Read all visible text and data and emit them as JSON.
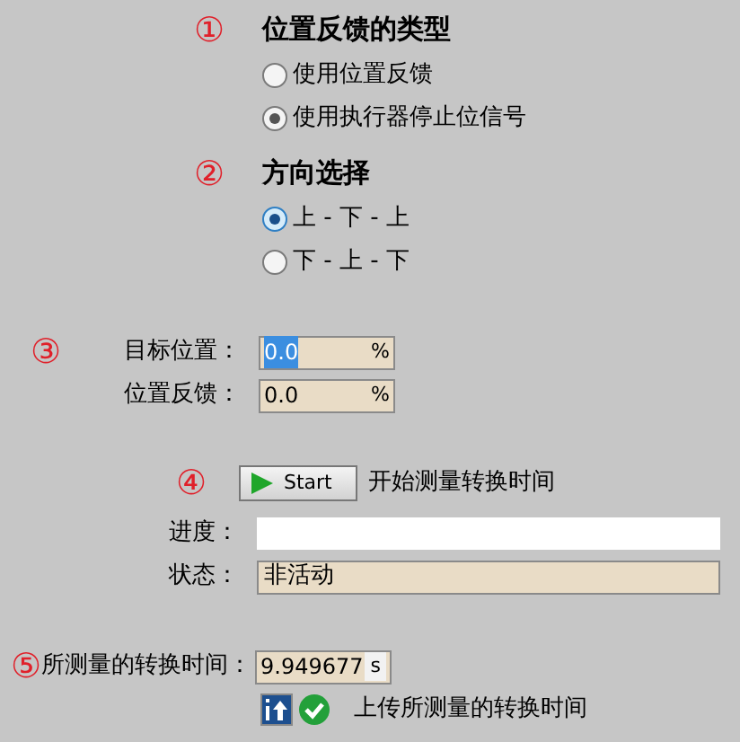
{
  "feedback_type": {
    "marker": "①",
    "title": "位置反馈的类型",
    "options": [
      {
        "label": "使用位置反馈",
        "selected": false
      },
      {
        "label": "使用执行器停止位信号",
        "selected": true
      }
    ]
  },
  "direction": {
    "marker": "②",
    "title": "方向选择",
    "options": [
      {
        "label": "上 - 下 - 上",
        "selected": true
      },
      {
        "label": "下 - 上 - 下",
        "selected": false
      }
    ]
  },
  "positions": {
    "marker": "③",
    "fields": [
      {
        "label": "目标位置：",
        "value": "0.0",
        "unit": "%",
        "text_selected": true
      },
      {
        "label": "位置反馈：",
        "value": "0.0",
        "unit": "%",
        "text_selected": false
      }
    ]
  },
  "measurement": {
    "marker": "④",
    "start_button": "Start",
    "start_caption": "开始测量转换时间",
    "progress": {
      "label": "进度：",
      "level": 0
    },
    "status": {
      "label": "状态：",
      "value": "非活动"
    }
  },
  "result": {
    "marker": "⑤",
    "label": "所测量的转换时间：",
    "value": "9.949677",
    "unit": "s",
    "upload_caption": "上传所测量的转换时间",
    "upload_ok": true
  }
}
